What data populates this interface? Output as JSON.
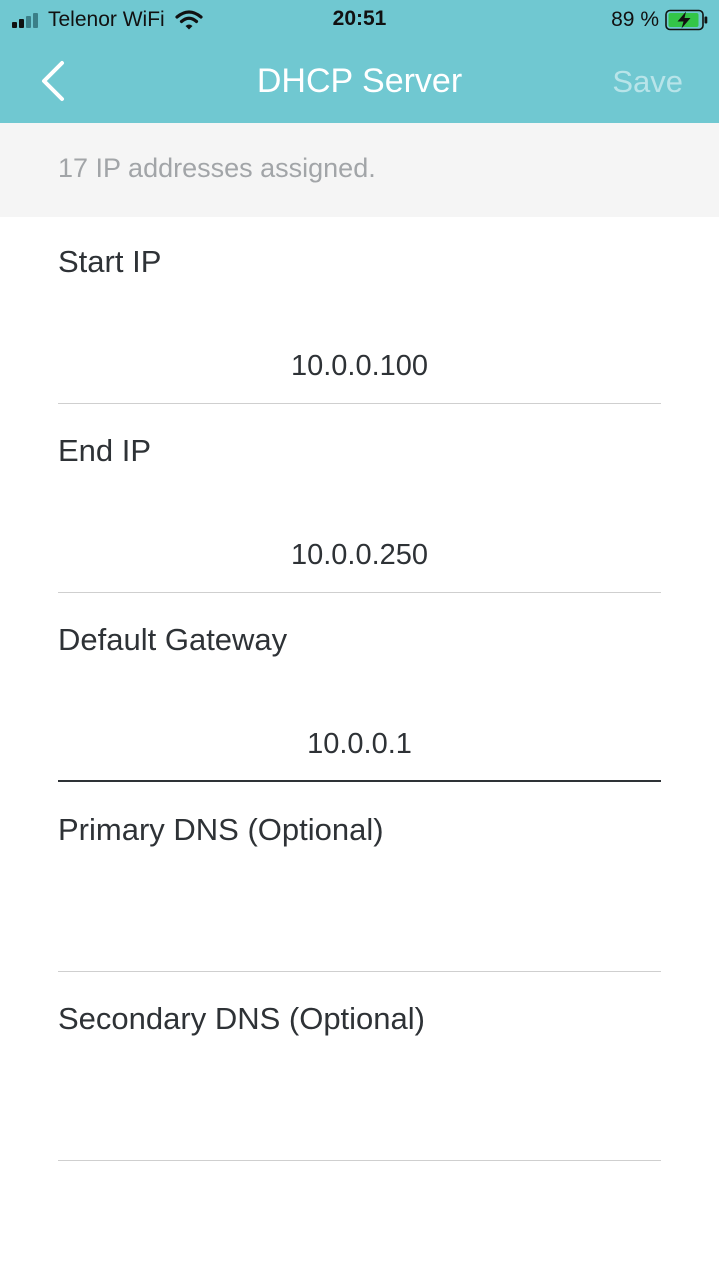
{
  "status_bar": {
    "carrier": "Telenor WiFi",
    "time": "20:51",
    "battery": "89 %"
  },
  "nav": {
    "title": "DHCP Server",
    "save_label": "Save",
    "back_icon": "chevron-left-icon"
  },
  "info": {
    "text": "17 IP addresses assigned."
  },
  "fields": [
    {
      "label": "Start IP",
      "value": "10.0.0.100"
    },
    {
      "label": "End IP",
      "value": "10.0.0.250"
    },
    {
      "label": "Default Gateway",
      "value": "10.0.0.1"
    },
    {
      "label": "Primary DNS (Optional)",
      "value": ""
    },
    {
      "label": "Secondary DNS (Optional)",
      "value": ""
    }
  ],
  "colors": {
    "header": "#70c8d1",
    "save_disabled": "#b8e4e9",
    "divider": "#cfcfcf",
    "active_divider": "#2e3236"
  }
}
